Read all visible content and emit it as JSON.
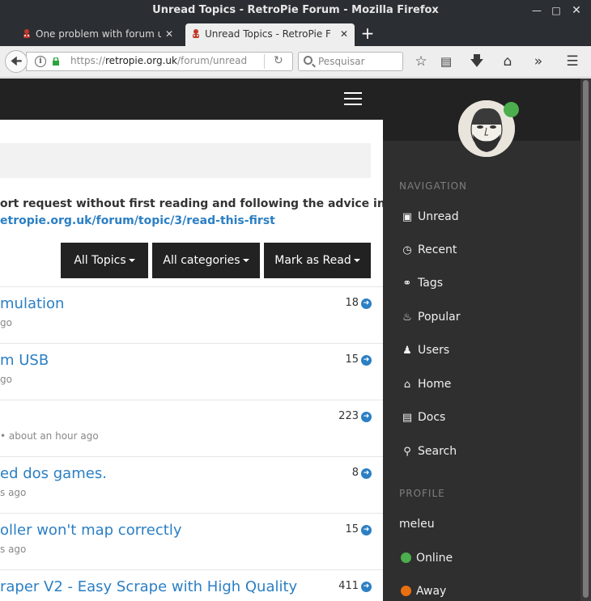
{
  "window": {
    "title": "Unread Topics - RetroPie Forum - Mozilla Firefox"
  },
  "tabs": [
    {
      "label": "One problem with forum up"
    },
    {
      "label": "Unread Topics - RetroPie Fo"
    }
  ],
  "toolbar": {
    "url_prefix": "https://",
    "url_host": "retropie.org.uk",
    "url_path": "/forum/unread",
    "search_placeholder": "Pesquisar"
  },
  "page": {
    "notice_line1": "ort request without first reading and following the advice in",
    "notice_link": "etropie.org.uk/forum/topic/3/read-this-first",
    "buttons": {
      "all_topics": "All Topics",
      "all_categories": "All categories",
      "mark_read": "Mark as Read"
    },
    "topics": [
      {
        "title": "mulation",
        "meta": "go",
        "count": "18"
      },
      {
        "title": "m USB",
        "meta": "go",
        "count": "15"
      },
      {
        "title": "",
        "meta": "• about an hour ago",
        "count": "223"
      },
      {
        "title": "ed dos games.",
        "meta": "s ago",
        "count": "8"
      },
      {
        "title": "oller won't map correctly",
        "meta": "s ago",
        "count": "15"
      },
      {
        "title": "raper V2 - Easy Scrape with High Quality",
        "meta": "",
        "count": "411"
      }
    ]
  },
  "sidebar": {
    "navigation_heading": "NAVIGATION",
    "nav": [
      {
        "label": "Unread",
        "icon": "inbox-icon"
      },
      {
        "label": "Recent",
        "icon": "clock-icon"
      },
      {
        "label": "Tags",
        "icon": "tags-icon"
      },
      {
        "label": "Popular",
        "icon": "fire-icon"
      },
      {
        "label": "Users",
        "icon": "user-icon"
      },
      {
        "label": "Home",
        "icon": "home-icon"
      },
      {
        "label": "Docs",
        "icon": "book-icon"
      },
      {
        "label": "Search",
        "icon": "search-icon"
      }
    ],
    "profile_heading": "PROFILE",
    "username": "meleu",
    "status_online": "Online",
    "status_away": "Away"
  },
  "colors": {
    "accent": "#2b7fc4",
    "header": "#222222",
    "sidebar": "#2f2f2f",
    "online": "#4cae4c",
    "away": "#e8700f"
  }
}
